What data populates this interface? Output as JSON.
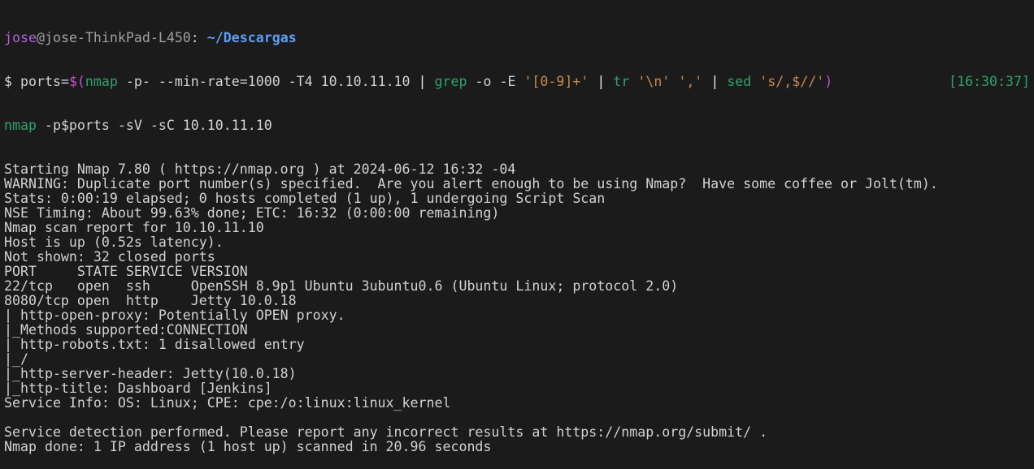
{
  "prompt": {
    "user": "jose",
    "at": "@",
    "host": "jose-ThinkPad-L450",
    "colon": ":",
    "path": " ~/Descargas"
  },
  "command_line_1": [
    {
      "t": "$ ports=",
      "c": "def"
    },
    {
      "t": "$(",
      "c": "sub"
    },
    {
      "t": "nmap",
      "c": "cmd"
    },
    {
      "t": " -p- --min-rate=1000 -T4 10.10.11.10 ",
      "c": "def"
    },
    {
      "t": "|",
      "c": "pipe"
    },
    {
      "t": " ",
      "c": "def"
    },
    {
      "t": "grep",
      "c": "cmd"
    },
    {
      "t": " -o -E ",
      "c": "def"
    },
    {
      "t": "'[0-9]+'",
      "c": "str"
    },
    {
      "t": " ",
      "c": "def"
    },
    {
      "t": "|",
      "c": "pipe"
    },
    {
      "t": " ",
      "c": "def"
    },
    {
      "t": "tr",
      "c": "cmd"
    },
    {
      "t": " ",
      "c": "def"
    },
    {
      "t": "'\\n'",
      "c": "str"
    },
    {
      "t": " ",
      "c": "def"
    },
    {
      "t": "','",
      "c": "str"
    },
    {
      "t": " ",
      "c": "def"
    },
    {
      "t": "|",
      "c": "pipe"
    },
    {
      "t": " ",
      "c": "def"
    },
    {
      "t": "sed",
      "c": "cmd"
    },
    {
      "t": " ",
      "c": "def"
    },
    {
      "t": "'s/,$//'",
      "c": "str"
    },
    {
      "t": ")",
      "c": "sub"
    }
  ],
  "timestamp": "[16:30:37]",
  "command_line_2": [
    {
      "t": "nmap",
      "c": "cmd"
    },
    {
      "t": " -p$ports -sV -sC 10.10.11.10",
      "c": "def"
    }
  ],
  "output": [
    "Starting Nmap 7.80 ( https://nmap.org ) at 2024-06-12 16:32 -04",
    "WARNING: Duplicate port number(s) specified.  Are you alert enough to be using Nmap?  Have some coffee or Jolt(tm).",
    "Stats: 0:00:19 elapsed; 0 hosts completed (1 up), 1 undergoing Script Scan",
    "NSE Timing: About 99.63% done; ETC: 16:32 (0:00:00 remaining)",
    "Nmap scan report for 10.10.11.10",
    "Host is up (0.52s latency).",
    "Not shown: 32 closed ports",
    "PORT     STATE SERVICE VERSION",
    "22/tcp   open  ssh     OpenSSH 8.9p1 Ubuntu 3ubuntu0.6 (Ubuntu Linux; protocol 2.0)",
    "8080/tcp open  http    Jetty 10.0.18",
    "| http-open-proxy: Potentially OPEN proxy.",
    "|_Methods supported:CONNECTION",
    "| http-robots.txt: 1 disallowed entry",
    "|_/",
    "|_http-server-header: Jetty(10.0.18)",
    "|_http-title: Dashboard [Jenkins]",
    "Service Info: OS: Linux; CPE: cpe:/o:linux:linux_kernel",
    "",
    "Service detection performed. Please report any incorrect results at https://nmap.org/submit/ .",
    "Nmap done: 1 IP address (1 host up) scanned in 20.96 seconds"
  ]
}
